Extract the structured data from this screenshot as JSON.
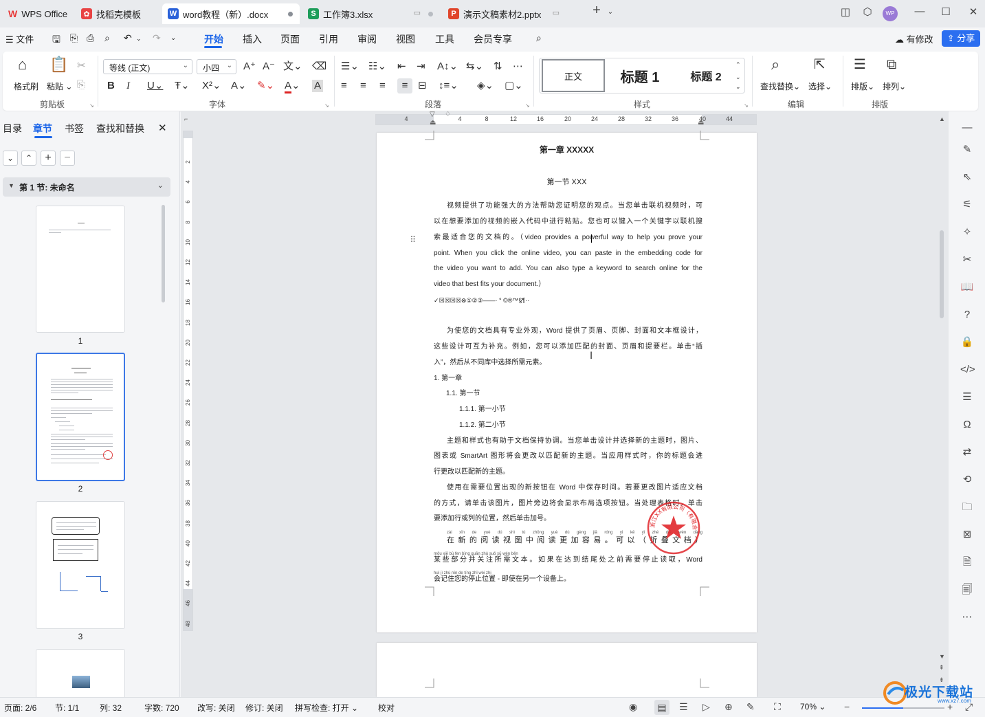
{
  "tabs": [
    {
      "label": "WPS Office",
      "color": "#e83a3a",
      "icon": "W"
    },
    {
      "label": "找稻壳模板",
      "color": "#e84343",
      "icon": "稻"
    },
    {
      "label": "word教程（新）.docx",
      "color": "#2b62d9",
      "icon": "W"
    },
    {
      "label": "工作簿3.xlsx",
      "color": "#1e9d5a",
      "icon": "S"
    },
    {
      "label": "演示文稿素材2.pptx",
      "color": "#e0452b",
      "icon": "P"
    }
  ],
  "menu": {
    "file": "文件",
    "items": [
      "开始",
      "插入",
      "页面",
      "引用",
      "审阅",
      "视图",
      "工具",
      "会员专享"
    ],
    "modified": "有修改",
    "share": "分享"
  },
  "ribbon": {
    "format_painter": "格式刷",
    "paste": "粘贴",
    "font_name": "等线 (正文)",
    "font_size": "小四",
    "styles": [
      "正文",
      "标题 1",
      "标题 2"
    ],
    "find_replace": "查找替换",
    "select": "选择",
    "layout": "排版",
    "arrange": "排列",
    "groups": [
      "剪贴板",
      "字体",
      "段落",
      "样式",
      "编辑",
      "排版"
    ]
  },
  "left_panel": {
    "tabs": [
      "目录",
      "章节",
      "书签",
      "查找和替换"
    ],
    "section_title": "第 1 节: 未命名",
    "page_numbers": [
      "1",
      "2",
      "3"
    ]
  },
  "ruler": {
    "h_ticks": [
      "4",
      "4",
      "8",
      "12",
      "16",
      "20",
      "24",
      "28",
      "32",
      "36",
      "40",
      "44"
    ],
    "v_ticks": [
      "2",
      "4",
      "6",
      "8",
      "10",
      "12",
      "14",
      "16",
      "18",
      "20",
      "22",
      "24",
      "26",
      "28",
      "30",
      "32",
      "34",
      "36",
      "38",
      "40",
      "42",
      "44",
      "46",
      "48"
    ]
  },
  "document": {
    "chapter": "第一章  XXXXX",
    "section": "第一节  XXX",
    "para1_lines": [
      "视频提供了功能强大的方法帮助您证明您的观点。当您单击联机视频时，可",
      "以在想要添加的视频的嵌入代码中进行粘贴。您也可以键入一个关键字以联机搜",
      "索最适合您的文档的。（video provides a powerful way to help you prove your",
      "point. When you click the online video, you can paste in the embedding code for",
      "the video you want to add. You can also type a keyword to search online for the",
      "video that best fits your document.）"
    ],
    "symbols": "✓☒☒☒☒⊗①②③——·  °  ©®™§¶··",
    "para2_lines": [
      "为使您的文档具有专业外观，Word 提供了页眉、页脚、封面和文本框设计，",
      "这些设计可互为补充。例如，您可以添加匹配的封面、页眉和提要栏。单击“插",
      "入”，然后从不同库中选择所需元素。"
    ],
    "list": [
      "1.   第一章",
      "1.1.  第一节",
      "1.1.1.   第一小节",
      "1.1.2.   第二小节"
    ],
    "para3_lines": [
      "主题和样式也有助于文档保持协调。当您单击设计并选择新的主题时，图片、",
      "图表或 SmartArt 图形将会更改以匹配新的主题。当应用样式时，你的标题会进",
      "行更改以匹配新的主题。"
    ],
    "para4_lines": [
      "使用在需要位置出现的新按钮在 Word 中保存时间。若要更改图片适应文档",
      "的方式，请单击该图片，图片旁边将会显示布局选项按钮。当处理表格时，单击",
      "要添加行或列的位置，然后单击加号。"
    ],
    "para5_lines": [
      "在新的阅读视图中阅读更加容易。可以（折叠文档）",
      "某些部分并关注所需文本。如果在达到结尾处之前需要停止读取，Word",
      "会记住您的停止位置 - 即使在另一个设备上。"
    ],
    "pinyin5": [
      "zài xīn de yuè dú shì tú zhōng yuè dú gèng jiā róng yì    kě yǐ     zhé dié wén dàng",
      "mǒu xiē bù fen bìng guān zhù suǒ xū wén běn",
      "huì jì zhù nín de tíng zhǐ wèi zhi"
    ],
    "seal_text": "浙江XX有限公司（有限合伙）"
  },
  "status": {
    "page": "页面: 2/6",
    "section": "节: 1/1",
    "col": "列: 32",
    "words": "字数: 720",
    "rewrite": "改写: 关闭",
    "revise": "修订: 关闭",
    "spell": "拼写检查: 打开",
    "proof": "校对",
    "zoom": "70%"
  },
  "watermark": "极光下载站",
  "watermark_url": "www.xz7.com",
  "colors": {
    "accent": "#1b65e8",
    "seal": "#e0262a"
  }
}
